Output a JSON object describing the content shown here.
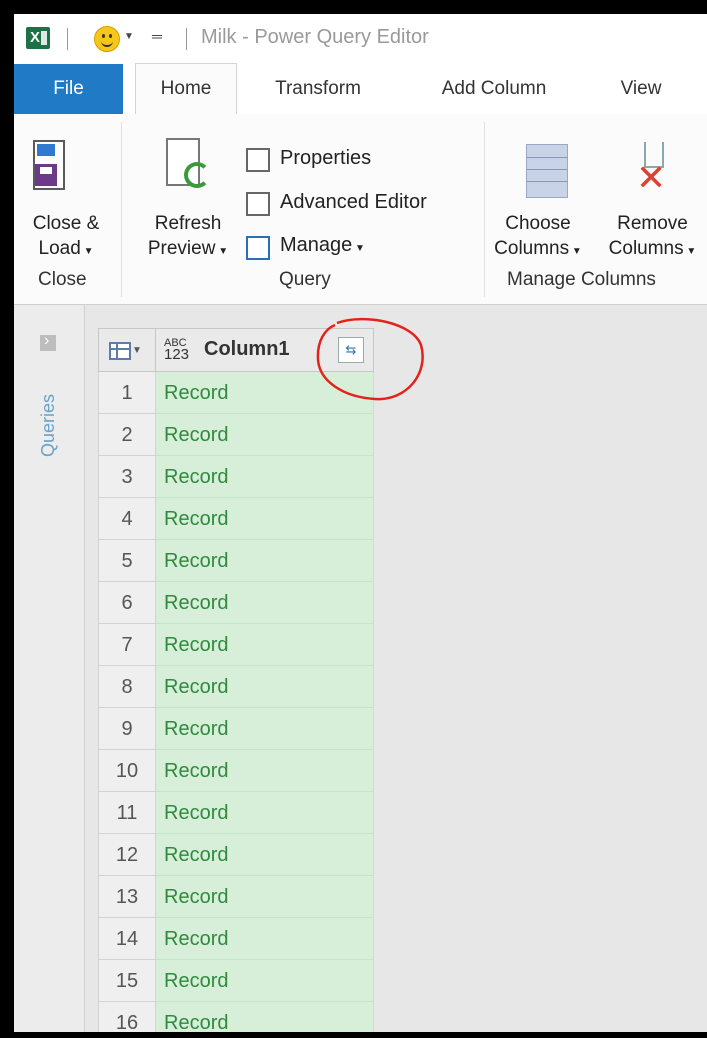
{
  "window": {
    "title": "Milk - Power Query Editor",
    "app_icon": "excel-icon",
    "quick_access_icon": "smiley-icon"
  },
  "tabs": [
    {
      "label": "File"
    },
    {
      "label": "Home"
    },
    {
      "label": "Transform"
    },
    {
      "label": "Add Column"
    },
    {
      "label": "View"
    }
  ],
  "ribbon": {
    "close": {
      "line1": "Close &",
      "line2": "Load",
      "group": "Close"
    },
    "query": {
      "refresh_line1": "Refresh",
      "refresh_line2": "Preview",
      "properties": "Properties",
      "advanced_editor": "Advanced Editor",
      "manage": "Manage",
      "group": "Query"
    },
    "manage_columns": {
      "choose_line1": "Choose",
      "choose_line2": "Columns",
      "remove_line1": "Remove",
      "remove_line2": "Columns",
      "group": "Manage Columns"
    }
  },
  "queries_pane": {
    "label": "Queries"
  },
  "grid": {
    "type_icon_top": "ABC",
    "type_icon_bottom": "123",
    "column_header": "Column1",
    "rows": [
      {
        "n": "1",
        "v": "Record"
      },
      {
        "n": "2",
        "v": "Record"
      },
      {
        "n": "3",
        "v": "Record"
      },
      {
        "n": "4",
        "v": "Record"
      },
      {
        "n": "5",
        "v": "Record"
      },
      {
        "n": "6",
        "v": "Record"
      },
      {
        "n": "7",
        "v": "Record"
      },
      {
        "n": "8",
        "v": "Record"
      },
      {
        "n": "9",
        "v": "Record"
      },
      {
        "n": "10",
        "v": "Record"
      },
      {
        "n": "11",
        "v": "Record"
      },
      {
        "n": "12",
        "v": "Record"
      },
      {
        "n": "13",
        "v": "Record"
      },
      {
        "n": "14",
        "v": "Record"
      },
      {
        "n": "15",
        "v": "Record"
      },
      {
        "n": "16",
        "v": "Record"
      }
    ]
  },
  "annotation": {
    "color": "#e3231b"
  }
}
